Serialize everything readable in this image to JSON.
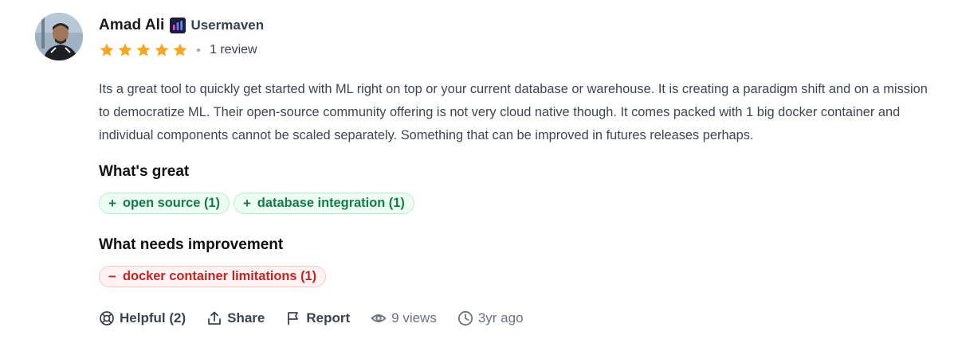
{
  "review": {
    "author": {
      "name": "Amad Ali",
      "company": "Usermaven",
      "company_logo_icon": "usermaven-logo",
      "review_count": "1 review"
    },
    "rating": 5,
    "rating_max": 5,
    "star_color": "#f5a623",
    "body": "Its a great tool to quickly get started with ML right on top or your current database or warehouse. It is creating a paradigm shift and on a mission to democratize ML. Their open-source community offering is not very cloud native though. It comes packed with 1 big docker container and individual components cannot be scaled separately. Something that can be improved in futures releases perhaps.",
    "whats_great": {
      "title": "What's great",
      "tags": [
        {
          "sign": "+",
          "label": "open source (1)"
        },
        {
          "sign": "+",
          "label": "database integration (1)"
        }
      ]
    },
    "needs_improvement": {
      "title": "What needs improvement",
      "tags": [
        {
          "sign": "−",
          "label": "docker container limitations (1)"
        }
      ]
    },
    "actions": {
      "helpful": "Helpful (2)",
      "share": "Share",
      "report": "Report",
      "views": "9 views",
      "age": "3yr ago"
    }
  },
  "colors": {
    "positive_text": "#147a47",
    "positive_bg": "#ecfdf3",
    "negative_text": "#c02626",
    "negative_bg": "#fef2f2"
  }
}
